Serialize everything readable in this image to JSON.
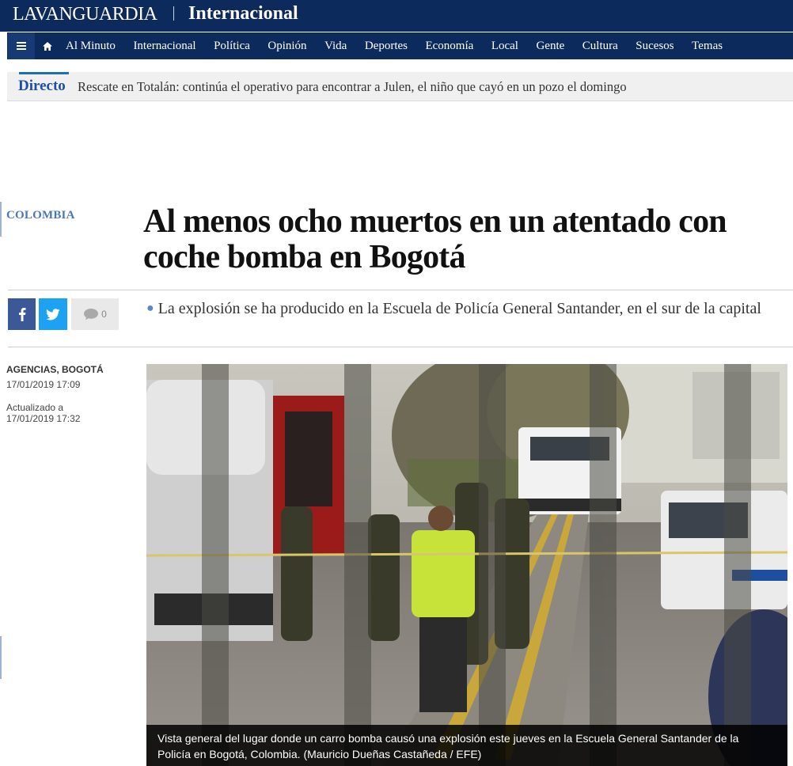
{
  "header": {
    "brand": "LAVANGUARDIA",
    "section": "Internacional"
  },
  "nav": {
    "menu_icon": "hamburger-icon",
    "home_icon": "home-icon",
    "items": [
      "Al Minuto",
      "Internacional",
      "Política",
      "Opinión",
      "Vida",
      "Deportes",
      "Economía",
      "Local",
      "Gente",
      "Cultura",
      "Sucesos",
      "Temas"
    ]
  },
  "live": {
    "label": "Directo",
    "text": "Rescate en Totalán: continúa el operativo para encontrar a Julen, el niño que cayó en un pozo el domingo"
  },
  "article": {
    "category": "COLOMBIA",
    "headline": "Al menos ocho muertos en un atentado con coche bomba en Bogotá",
    "subtitle": "La explosión se ha producido en la Escuela de Policía General Santander, en el sur de la capital",
    "agency": "AGENCIAS, BOGOTÁ",
    "published": "17/01/2019 17:09",
    "updated_label": "Actualizado a",
    "updated": "17/01/2019 17:32",
    "photo_caption": "Vista general del lugar donde un carro bomba causó una explosión este jueves en la Escuela General Santander de la Policía en Bogotá, Colombia. (Mauricio Dueñas Castañeda / EFE)"
  },
  "share": {
    "facebook_icon": "facebook-icon",
    "twitter_icon": "twitter-icon",
    "comment_icon": "comment-icon",
    "comment_count": "0"
  },
  "colors": {
    "brand_navy": "#0c2a5b",
    "accent_blue": "#1e4fa2",
    "facebook": "#3b5998",
    "twitter": "#1da1f2"
  }
}
